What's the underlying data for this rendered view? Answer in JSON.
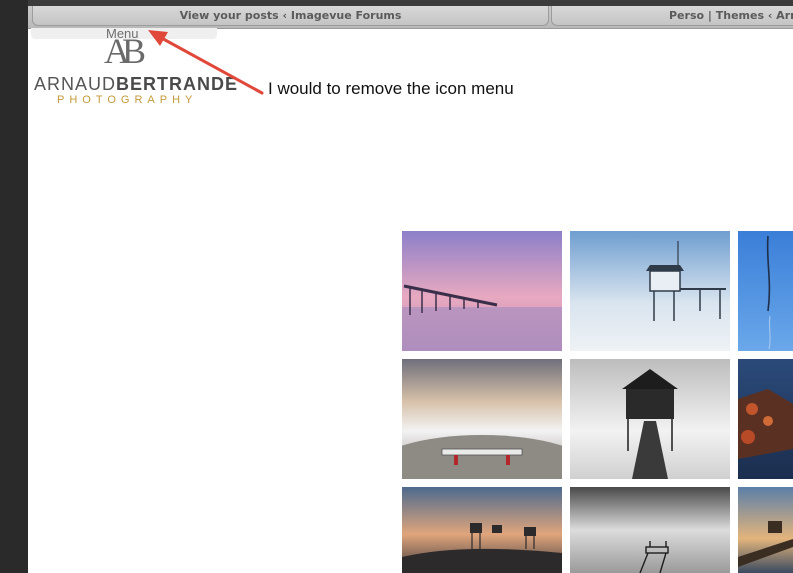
{
  "browser": {
    "tabs": [
      {
        "label": "View your posts ‹ Imagevue Forums"
      },
      {
        "label": "Perso | Themes ‹ Arna"
      }
    ]
  },
  "site": {
    "menu_label": "Menu",
    "logo": {
      "mark": "AB",
      "name_light": "ARNAUD",
      "name_bold": "BERTRANDE",
      "tagline": "PHOTOGRAPHY"
    }
  },
  "annotation": {
    "text": "I would to remove the icon menu",
    "arrow_color": "#e0483a"
  },
  "gallery": {
    "thumbnails": [
      {
        "name": "pier-sunset"
      },
      {
        "name": "fishing-hut-mist"
      },
      {
        "name": "blue-branch"
      },
      {
        "name": "bench-long-exposure"
      },
      {
        "name": "bw-pavilion-jetty"
      },
      {
        "name": "red-rocks-sea"
      },
      {
        "name": "stilt-huts-sunset"
      },
      {
        "name": "bw-diving-platform"
      },
      {
        "name": "wooden-walkway-dusk"
      }
    ]
  }
}
